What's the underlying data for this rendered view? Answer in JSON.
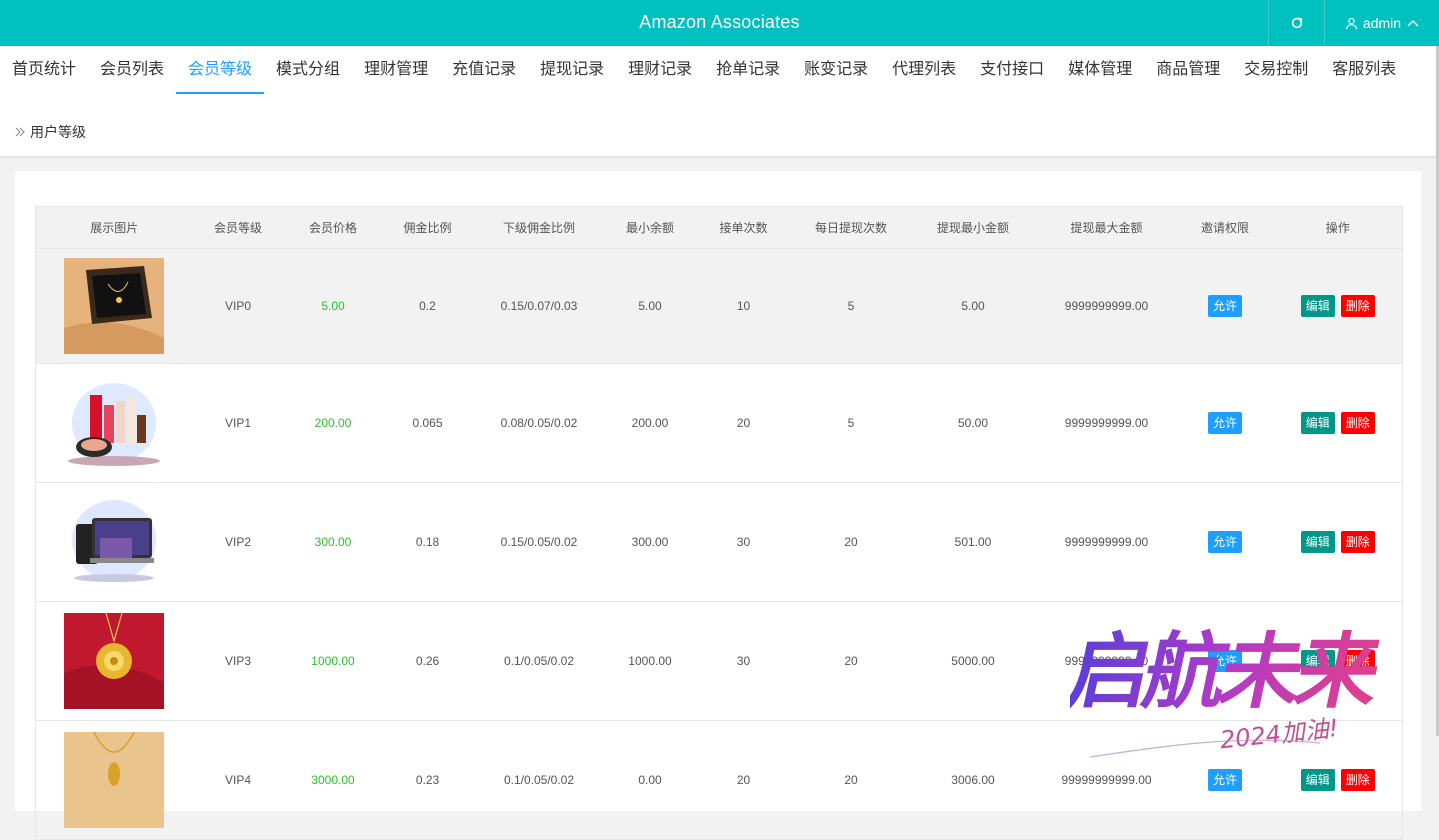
{
  "app": {
    "title": "Amazon Associates",
    "user": "admin"
  },
  "nav": {
    "tabs": [
      "首页统计",
      "会员列表",
      "会员等级",
      "模式分组",
      "理财管理",
      "充值记录",
      "提现记录",
      "理财记录",
      "抢单记录",
      "账变记录",
      "代理列表",
      "支付接口",
      "媒体管理",
      "商品管理",
      "交易控制",
      "客服列表"
    ],
    "active_index": 2
  },
  "breadcrumb": {
    "label": "用户等级"
  },
  "table": {
    "headers": [
      "展示图片",
      "会员等级",
      "会员价格",
      "佣金比例",
      "下级佣金比例",
      "最小余额",
      "接单次数",
      "每日提现次数",
      "提现最小金额",
      "提现最大金额",
      "邀请权限",
      "操作"
    ],
    "rows": [
      {
        "image": "gift-box-necklace",
        "level": "VIP0",
        "price": "5.00",
        "commission": "0.2",
        "sub_commission": "0.15/0.07/0.03",
        "min_balance": "5.00",
        "orders": "10",
        "daily_withdraw": "5",
        "withdraw_min": "5.00",
        "withdraw_max": "9999999999.00",
        "invite": "允许",
        "edit": "编辑",
        "delete": "删除"
      },
      {
        "image": "cosmetics-set",
        "level": "VIP1",
        "price": "200.00",
        "commission": "0.065",
        "sub_commission": "0.08/0.05/0.02",
        "min_balance": "200.00",
        "orders": "20",
        "daily_withdraw": "5",
        "withdraw_min": "50.00",
        "withdraw_max": "9999999999.00",
        "invite": "允许",
        "edit": "编辑",
        "delete": "删除"
      },
      {
        "image": "electronics-devices",
        "level": "VIP2",
        "price": "300.00",
        "commission": "0.18",
        "sub_commission": "0.15/0.05/0.02",
        "min_balance": "300.00",
        "orders": "30",
        "daily_withdraw": "20",
        "withdraw_min": "501.00",
        "withdraw_max": "9999999999.00",
        "invite": "允许",
        "edit": "编辑",
        "delete": "删除"
      },
      {
        "image": "gold-pendant",
        "level": "VIP3",
        "price": "1000.00",
        "commission": "0.26",
        "sub_commission": "0.1/0.05/0.02",
        "min_balance": "1000.00",
        "orders": "30",
        "daily_withdraw": "20",
        "withdraw_min": "5000.00",
        "withdraw_max": "9999999999.00",
        "invite": "允许",
        "edit": "编辑",
        "delete": "删除"
      },
      {
        "image": "gold-necklace",
        "level": "VIP4",
        "price": "3000.00",
        "commission": "0.23",
        "sub_commission": "0.1/0.05/0.02",
        "min_balance": "0.00",
        "orders": "20",
        "daily_withdraw": "20",
        "withdraw_min": "3006.00",
        "withdraw_max": "99999999999.00",
        "invite": "允许",
        "edit": "编辑",
        "delete": "删除"
      }
    ]
  },
  "watermark": {
    "main": "启航未来",
    "sub": "2024加油!"
  },
  "colors": {
    "header": "#00c0c0",
    "active_tab": "#1e9fff",
    "price": "#2bc22b",
    "allow_btn": "#1e9fff",
    "edit_btn": "#009688",
    "delete_btn": "#ff0000"
  }
}
